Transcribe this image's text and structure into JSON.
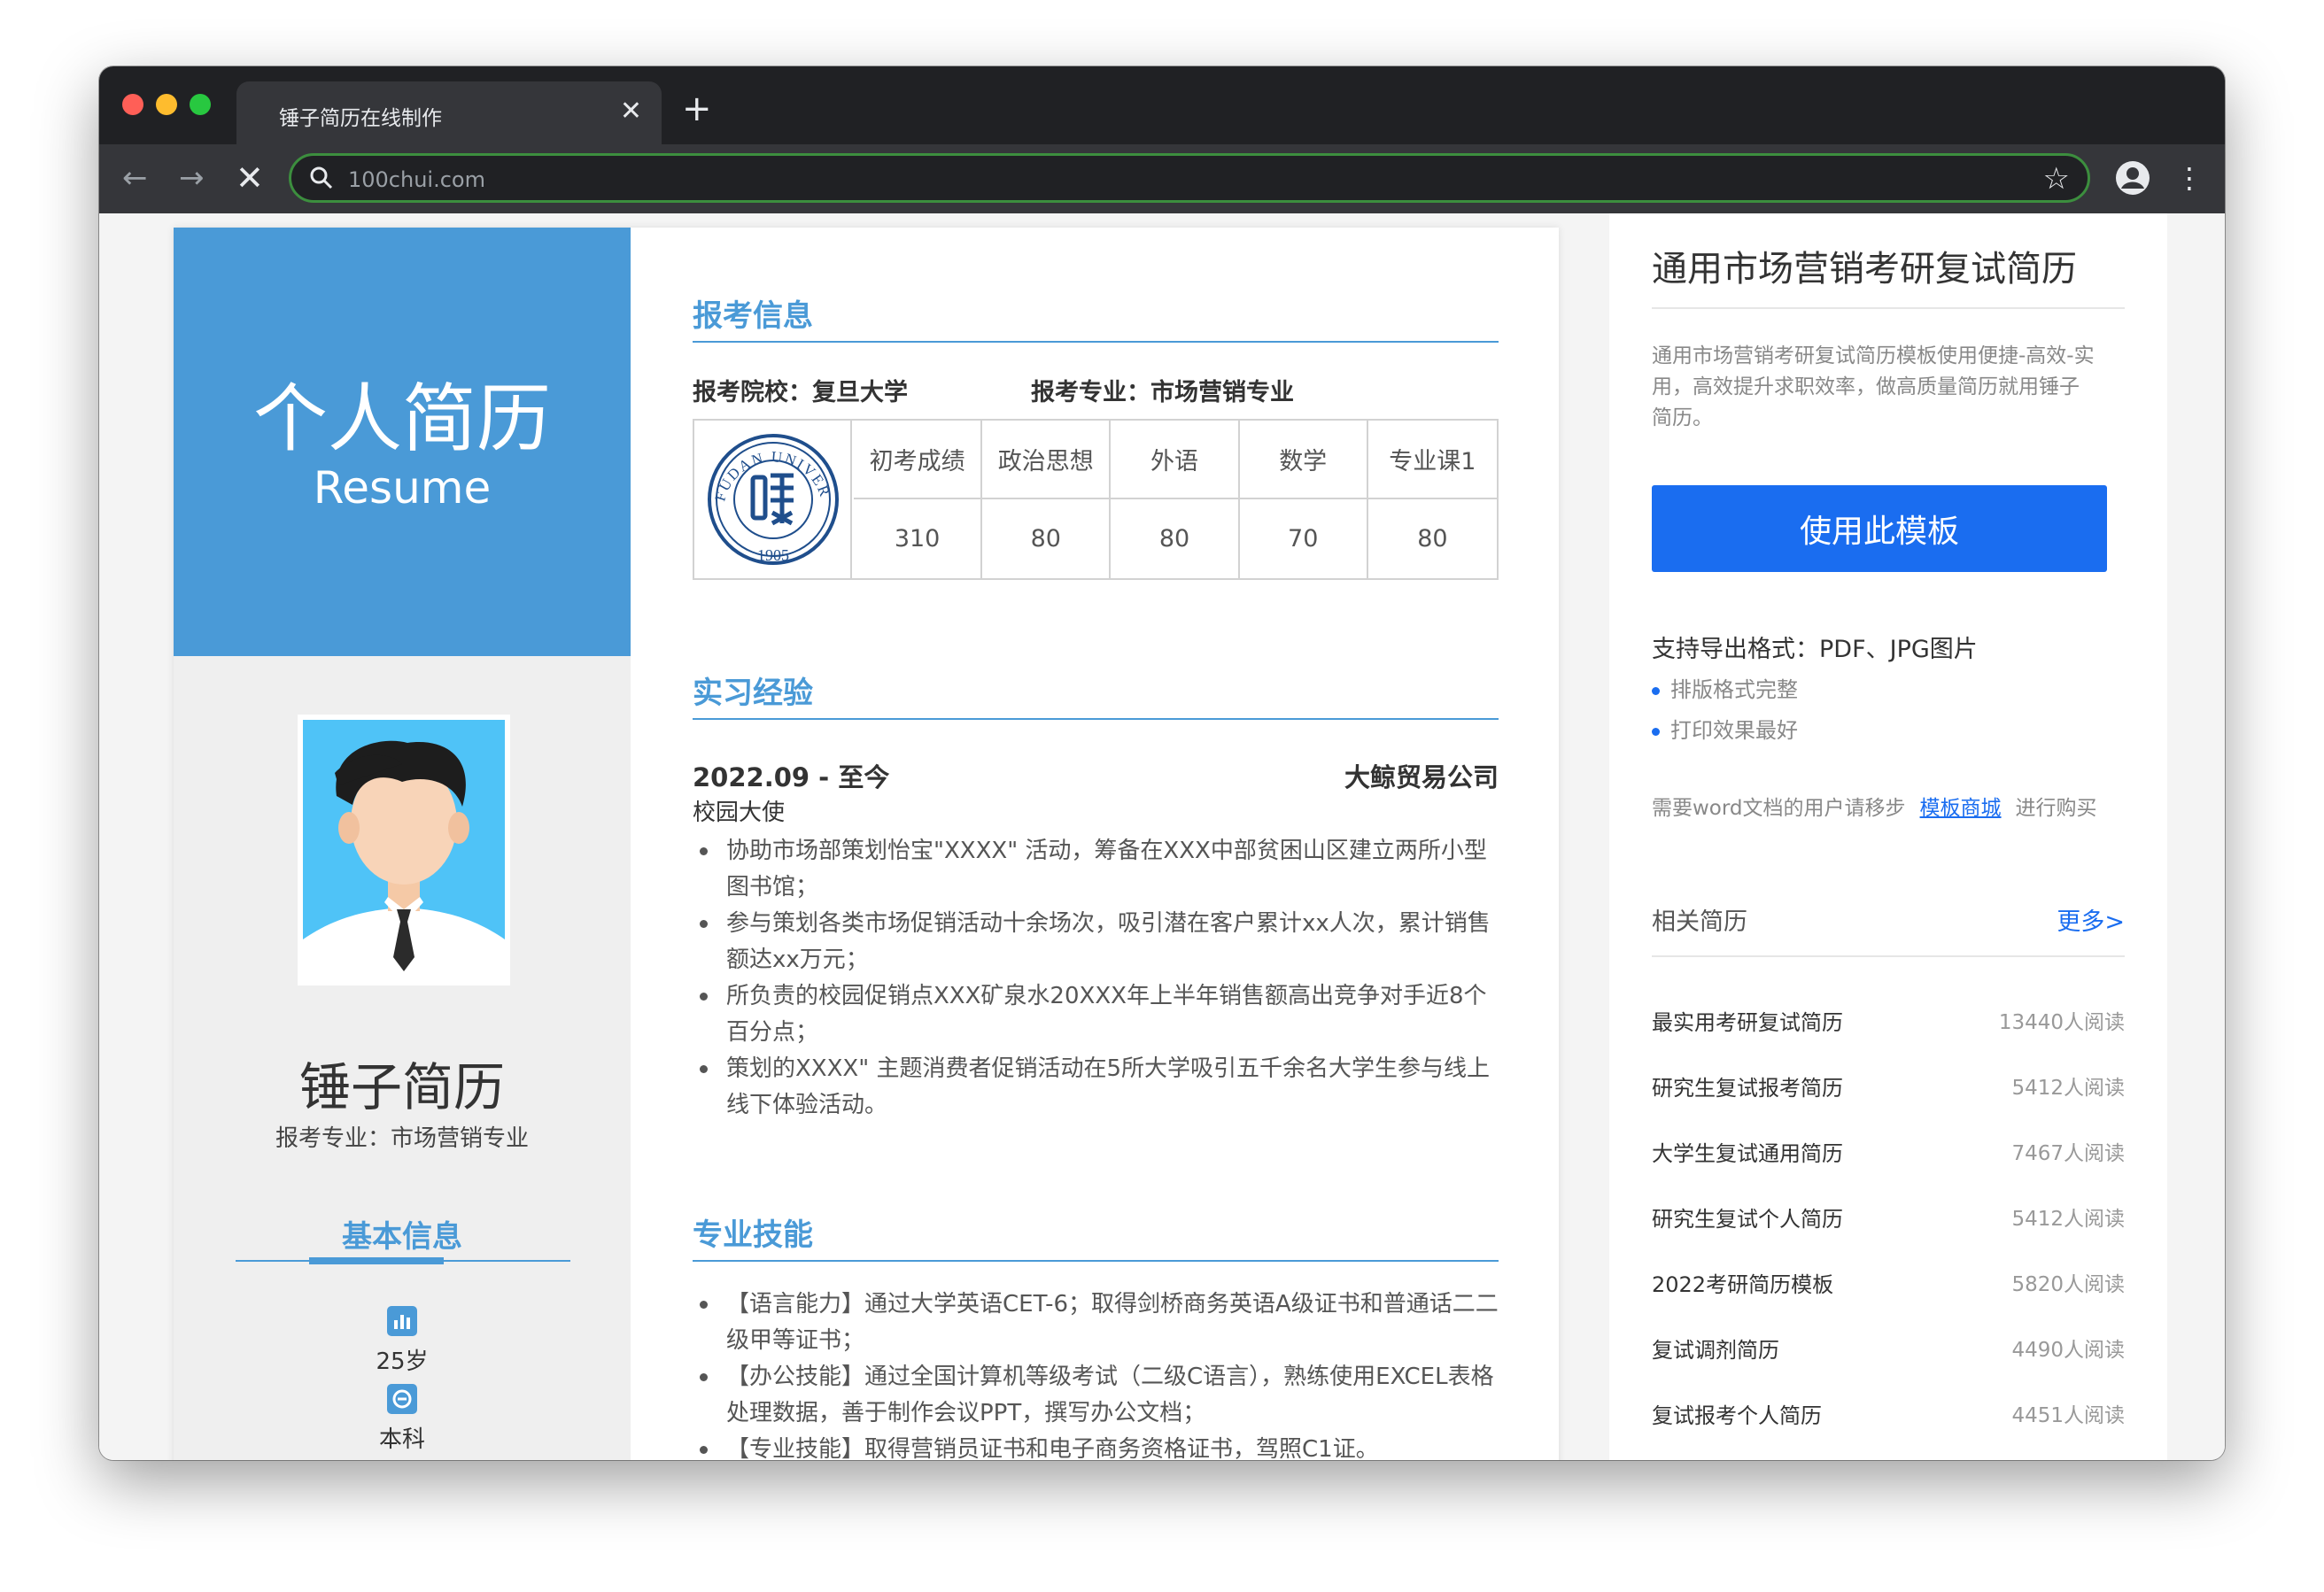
{
  "browser": {
    "tab_title": "锤子简历在线制作",
    "url": "100chui.com"
  },
  "resume": {
    "hero_title": "个人简历",
    "hero_subtitle": "Resume",
    "name": "锤子简历",
    "major": "报考专业：市场营销专业",
    "basic_info_title": "基本信息",
    "basic_info": [
      "25岁",
      "本科"
    ],
    "exam_section_title": "报考信息",
    "school_label": "报考院校：复旦大学",
    "major_label": "报考专业：市场营销专业",
    "seal": {
      "outer_text": "FUDAN UNIVERSITY",
      "year": "1905"
    },
    "score_headers": [
      "初考成绩",
      "政治思想",
      "外语",
      "数学",
      "专业课1"
    ],
    "score_values": [
      "310",
      "80",
      "80",
      "70",
      "80"
    ],
    "internship_title": "实习经验",
    "internship": {
      "date": "2022.09 - 至今",
      "company": "大鲸贸易公司",
      "role": "校园大使",
      "bullets": [
        "协助市场部策划怡宝\"XXXX\" 活动，筹备在XXX中部贫困山区建立两所小型图书馆；",
        "参与策划各类市场促销活动十余场次，吸引潜在客户累计xx人次，累计销售额达xx万元；",
        "所负责的校园促销点XXX矿泉水20XXX年上半年销售额高出竞争对手近8个百分点；",
        "策划的XXXX\" 主题消费者促销活动在5所大学吸引五千余名大学生参与线上线下体验活动。"
      ]
    },
    "skills_title": "专业技能",
    "skills": [
      "【语言能力】通过大学英语CET-6；取得剑桥商务英语A级证书和普通话二二级甲等证书；",
      "【办公技能】通过全国计算机等级考试（二级C语言），熟练使用EXCEL表格处理数据，善于制作会议PPT，撰写办公文档；",
      "【专业技能】取得营销员证书和电子商务资格证书，驾照C1证。"
    ]
  },
  "sidebar": {
    "title": "通用市场营销考研复试简历",
    "description": "通用市场营销考研复试简历模板使用便捷-高效-实用，高效提升求职效率，做高质量简历就用锤子简历。",
    "use_button": "使用此模板",
    "formats": "支持导出格式：PDF、JPG图片",
    "features": [
      "排版格式完整",
      "打印效果最好"
    ],
    "word_note_prefix": "需要word文档的用户请移步",
    "word_note_link": "模板商城",
    "word_note_suffix": "进行购买",
    "related_title": "相关简历",
    "more_link": "更多>",
    "related": [
      {
        "name": "最实用考研复试简历",
        "count": "13440人阅读"
      },
      {
        "name": "研究生复试报考简历",
        "count": "5412人阅读"
      },
      {
        "name": "大学生复试通用简历",
        "count": "7467人阅读"
      },
      {
        "name": "研究生复试个人简历",
        "count": "5412人阅读"
      },
      {
        "name": "2022考研简历模板",
        "count": "5820人阅读"
      },
      {
        "name": "复试调剂简历",
        "count": "4490人阅读"
      },
      {
        "name": "复试报考个人简历",
        "count": "4451人阅读"
      }
    ]
  },
  "colors": {
    "accent_blue": "#4a9ad7",
    "button_blue": "#1a6df0",
    "browser_dark": "#202124"
  }
}
